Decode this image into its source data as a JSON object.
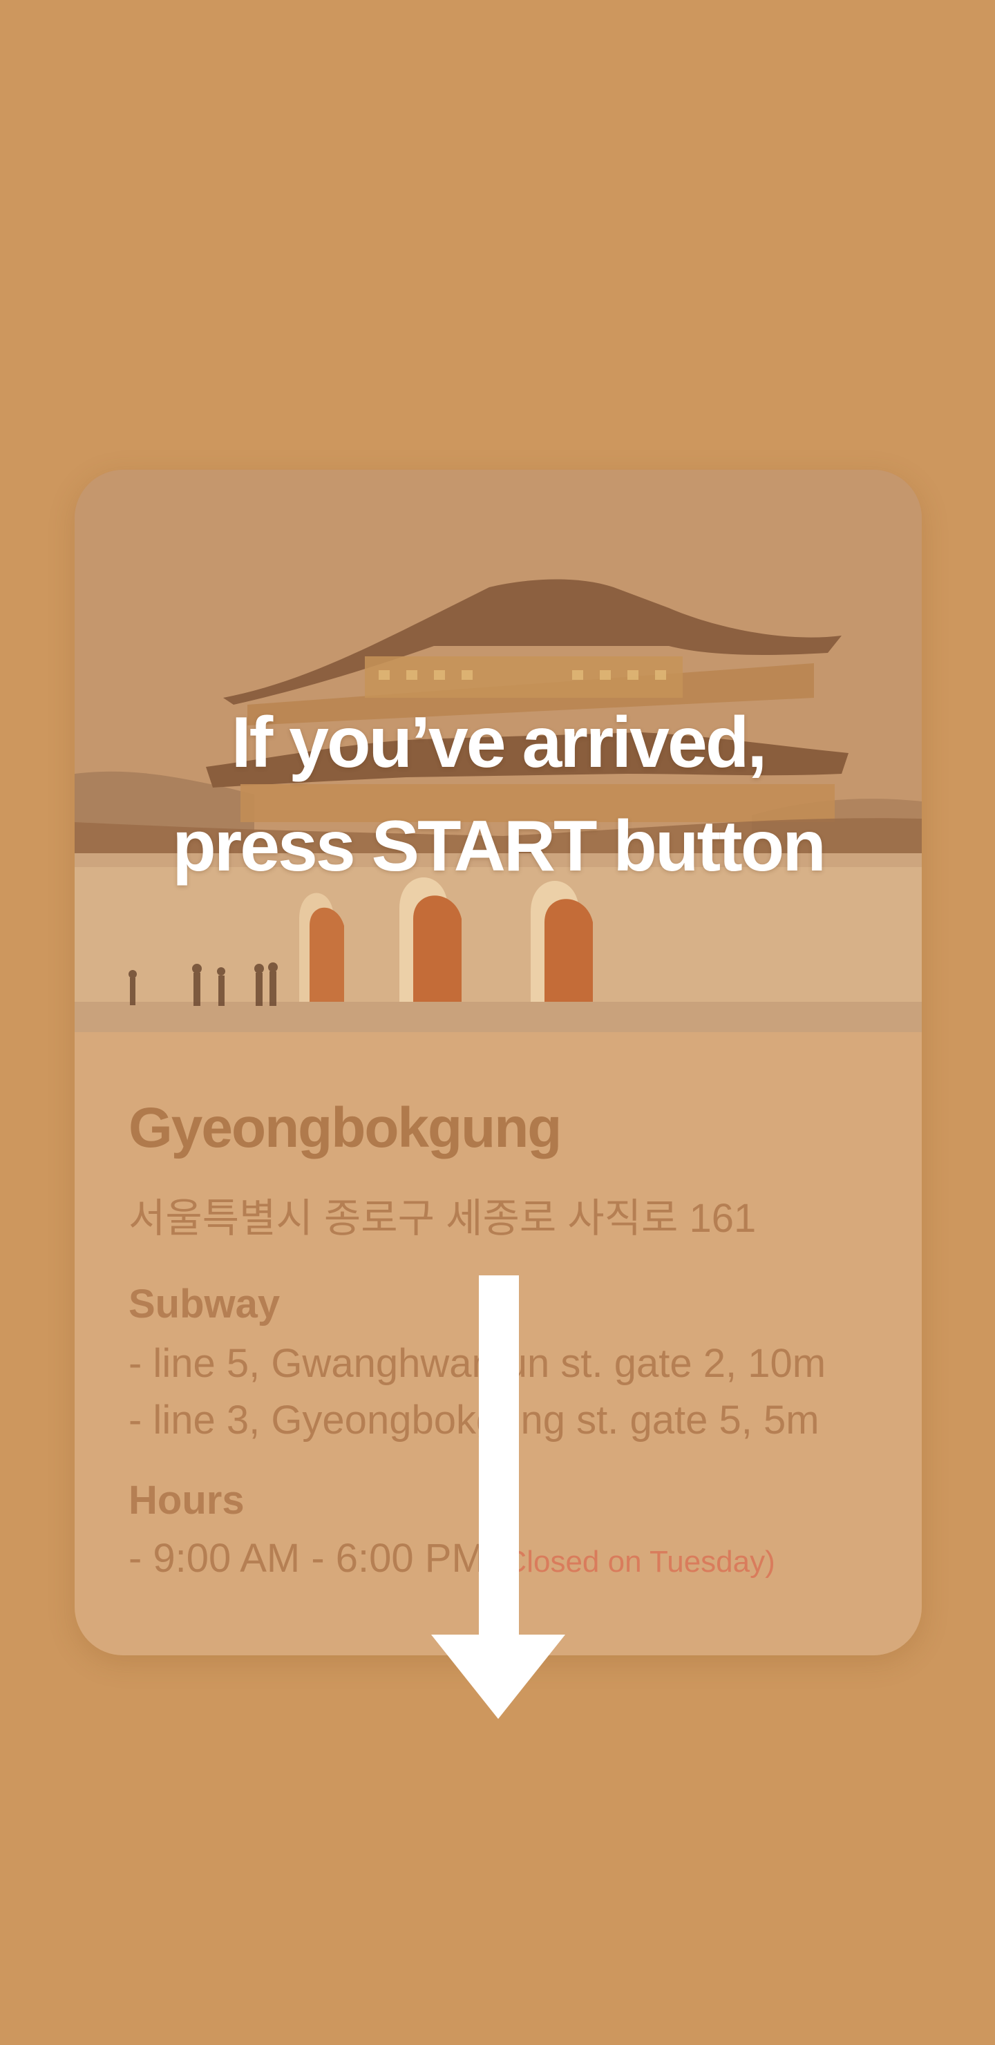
{
  "hero": {
    "line1": "If you’ve arrived,",
    "line2": "press START button"
  },
  "place": {
    "name": "Gyeongbokgung",
    "address": "서울특별시 종로구 세종로 사직로 161"
  },
  "subway": {
    "label": "Subway",
    "lines": [
      "- line 5, Gwanghwamun st. gate 2, 10m",
      "- line 3, Gyeongbokgung st. gate 5, 5m"
    ]
  },
  "hours": {
    "label": "Hours",
    "time": "- 9:00 AM - 6:00 PM",
    "note": "(Closed on Tuesday)"
  },
  "colors": {
    "background": "#cd975e",
    "info_panel": "#d7a97b",
    "text_brown": "#b57f53",
    "note_accent": "#d97c5c",
    "arrow": "#ffffff"
  },
  "icons": {
    "arrow": "down-arrow-icon"
  }
}
